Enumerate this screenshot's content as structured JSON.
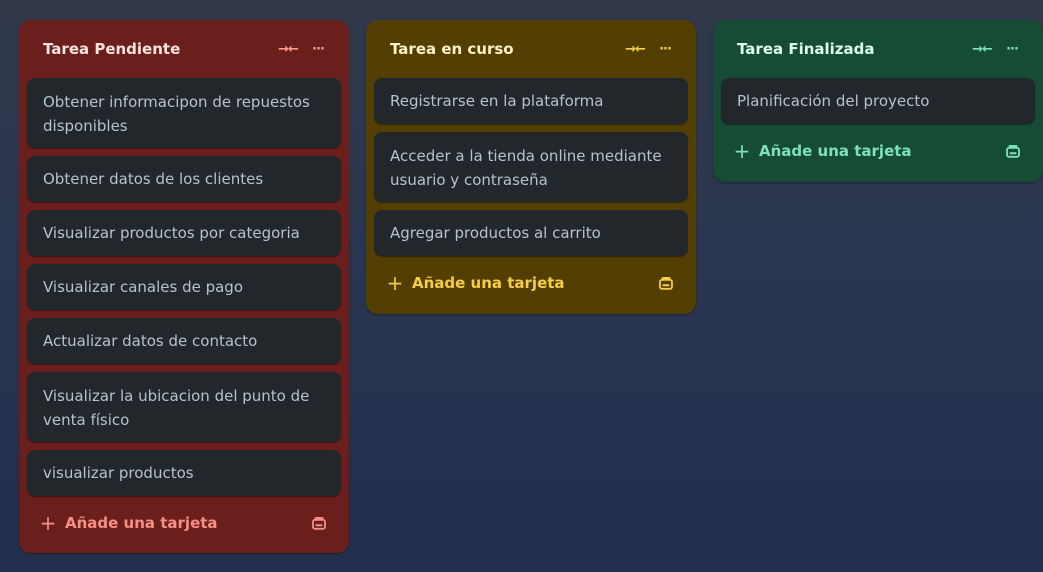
{
  "lists": [
    {
      "title": "Tarea Pendiente",
      "collapse_icon": "→←",
      "menu_icon": "···",
      "cards": [
        "Obtener informacipon de repuestos disponibles",
        "Obtener datos de los clientes",
        "Visualizar productos por categoria",
        "Visualizar canales de pago",
        "Actualizar datos de contacto",
        "Visualizar la ubicacion del punto de venta físico",
        "visualizar productos"
      ],
      "add_card_label": "Añade una tarjeta",
      "color": "#6b1f1d"
    },
    {
      "title": "Tarea en curso",
      "collapse_icon": "→←",
      "menu_icon": "···",
      "cards": [
        "Registrarse en la plataforma",
        "Acceder a la tienda online mediante usuario y contraseña",
        "Agregar productos al carrito"
      ],
      "add_card_label": "Añade una tarjeta",
      "color": "#533f04"
    },
    {
      "title": "Tarea Finalizada",
      "collapse_icon": "→←",
      "menu_icon": "···",
      "cards": [
        "Planificación del proyecto"
      ],
      "add_card_label": "Añade una tarjeta",
      "color": "#164b35"
    }
  ],
  "icons": {
    "add": "plus-icon",
    "template": "card-template-icon",
    "collapse": "collapse-list-icon",
    "menu": "more-options-icon"
  }
}
